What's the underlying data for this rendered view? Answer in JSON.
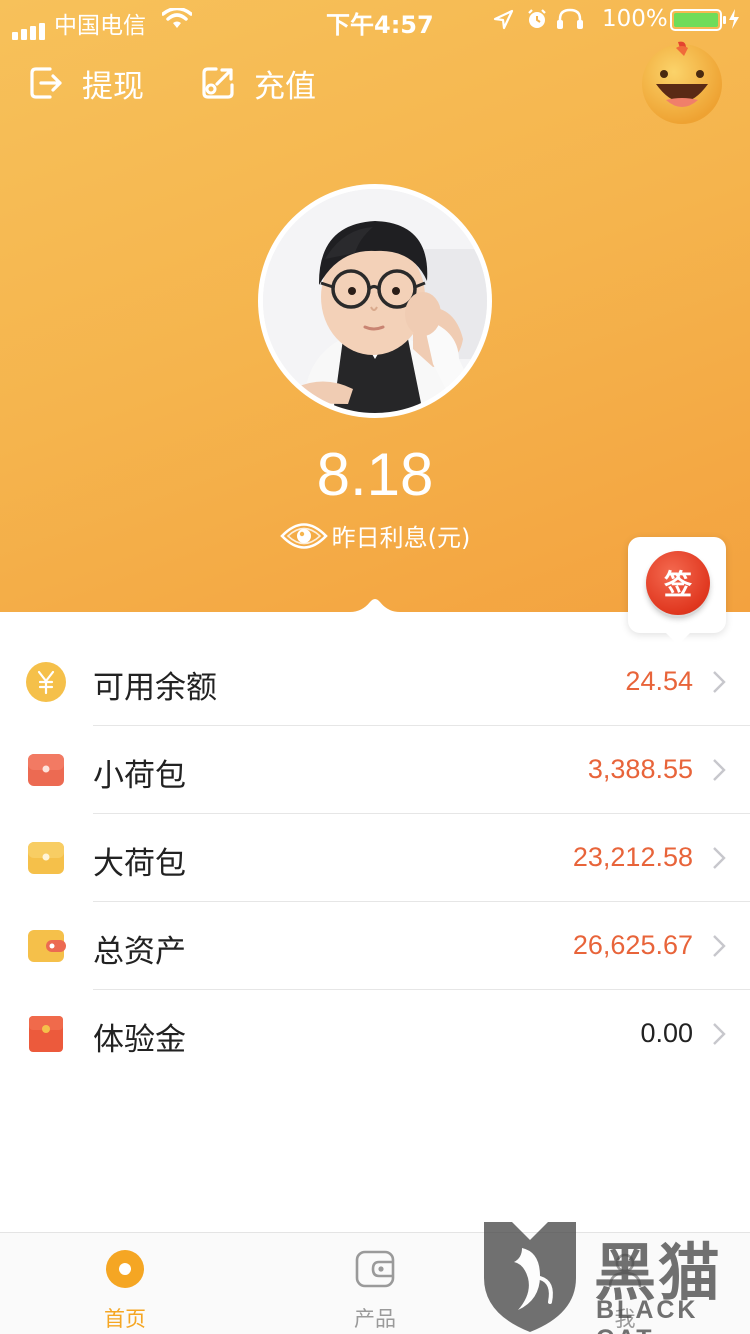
{
  "status_bar": {
    "carrier": "中国电信",
    "time": "下午4:57",
    "battery_pct": "100%"
  },
  "header": {
    "withdraw_label": "提现",
    "recharge_label": "充值"
  },
  "summary": {
    "interest_value": "8.18",
    "interest_label": "昨日利息(元)"
  },
  "sign_in": {
    "label": "签"
  },
  "accounts": [
    {
      "label": "可用余额",
      "value": "24.54",
      "icon": "yuan-coin-icon",
      "icon_color": "#f5c04a",
      "value_color": "#e8643a"
    },
    {
      "label": "小荷包",
      "value": "3,388.55",
      "icon": "small-purse-icon",
      "icon_color": "#ec6a52",
      "value_color": "#e8643a"
    },
    {
      "label": "大荷包",
      "value": "23,212.58",
      "icon": "big-purse-icon",
      "icon_color": "#f5c04a",
      "value_color": "#e8643a"
    },
    {
      "label": "总资产",
      "value": "26,625.67",
      "icon": "wallet-icon",
      "icon_color": "#f5c04a",
      "value_color": "#e8643a"
    },
    {
      "label": "体验金",
      "value": "0.00",
      "icon": "trial-fund-icon",
      "icon_color": "#ec5a3c",
      "value_color": "#222222"
    }
  ],
  "tabs": [
    {
      "label": "首页",
      "icon": "home-icon",
      "active": true
    },
    {
      "label": "产品",
      "icon": "products-icon",
      "active": false
    },
    {
      "label": "我",
      "icon": "me-icon",
      "active": false
    }
  ],
  "watermark": {
    "text_cn": "黑猫",
    "text_en": "BLACK CAT"
  },
  "colors": {
    "accent": "#f5b44d",
    "value_orange": "#e8643a",
    "tab_active": "#f5a623",
    "tab_inactive": "#9a9a9a"
  }
}
